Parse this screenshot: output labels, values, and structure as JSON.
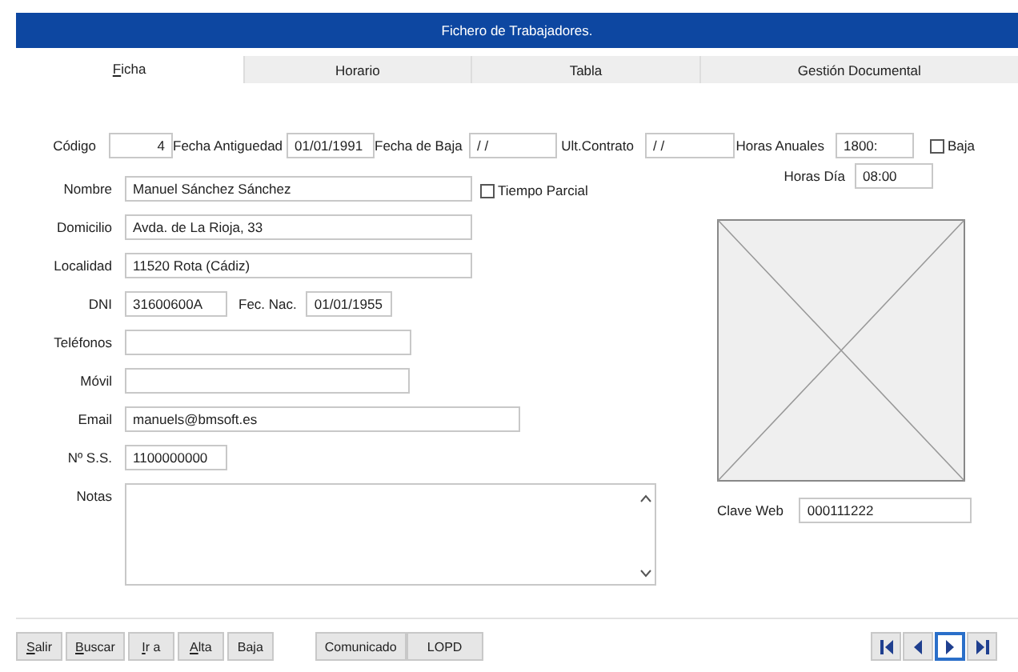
{
  "window": {
    "title": "Fichero de Trabajadores."
  },
  "tabs": [
    {
      "label": "Ficha",
      "selected": true,
      "underline_first": true
    },
    {
      "label": "Horario",
      "selected": false,
      "underline_first": false
    },
    {
      "label": "Tabla",
      "selected": false,
      "underline_first": false
    },
    {
      "label": "Gestión Documental",
      "selected": false,
      "underline_first": false
    }
  ],
  "top_row": [
    {
      "kind": "field",
      "label": "Código",
      "value": "4"
    },
    {
      "kind": "field",
      "label": "Fecha Antiguedad",
      "value": "01/01/1991"
    },
    {
      "kind": "field",
      "label": "Fecha de Baja",
      "value": " / /"
    },
    {
      "kind": "field",
      "label": "Ult.Contrato",
      "value": " / /"
    },
    {
      "kind": "field",
      "label": "Horas Anuales",
      "value": "1800:"
    },
    {
      "kind": "checkbox",
      "label": "Baja",
      "checked": false
    }
  ],
  "rows": [
    [
      {
        "kind": "field",
        "label": "Nombre",
        "value": "Manuel Sánchez Sánchez"
      },
      {
        "kind": "checkbox",
        "label": "Tiempo Parcial",
        "checked": false
      }
    ],
    [
      {
        "kind": "field",
        "label": "Domicilio",
        "value": "Avda. de La Rioja, 33"
      }
    ],
    [
      {
        "kind": "field",
        "label": "Localidad",
        "value": "11520 Rota (Cádiz)"
      }
    ],
    [
      {
        "kind": "field",
        "label": "DNI",
        "value": "31600600A"
      },
      {
        "kind": "field",
        "label": "Fec. Nac.",
        "value": "01/01/1955"
      }
    ],
    [
      {
        "kind": "field",
        "label": "Teléfonos"
      }
    ],
    [
      {
        "kind": "field",
        "label": "Móvil"
      }
    ],
    [
      {
        "kind": "field",
        "label": "Email",
        "value": "manuels@bmsoft.es"
      }
    ],
    [
      {
        "kind": "field",
        "label": "Nº S.S.",
        "value": "1100000000"
      }
    ],
    [
      {
        "kind": "textarea",
        "label": "Notas"
      }
    ]
  ],
  "horas_dia": {
    "label": "Horas Día",
    "value": "08:00"
  },
  "clave_web": {
    "label": "Clave Web",
    "value": "000111222"
  },
  "actions": [
    {
      "label": "Salir",
      "underline_first": true
    },
    {
      "label": "Buscar",
      "underline_first": true
    },
    {
      "label": "Ir a",
      "underline_first": true
    },
    {
      "label": "Alta",
      "underline_first": true
    },
    {
      "label": "Baja",
      "underline_first": false
    }
  ],
  "actions_2": [
    {
      "label": "Comunicado",
      "underline_first": false
    },
    {
      "label": "LOPD",
      "underline_first": false
    }
  ],
  "navigation": [
    {
      "kind": "first",
      "selected": false
    },
    {
      "kind": "previous",
      "selected": false
    },
    {
      "kind": "next",
      "selected": true
    },
    {
      "kind": "last",
      "selected": false
    }
  ]
}
